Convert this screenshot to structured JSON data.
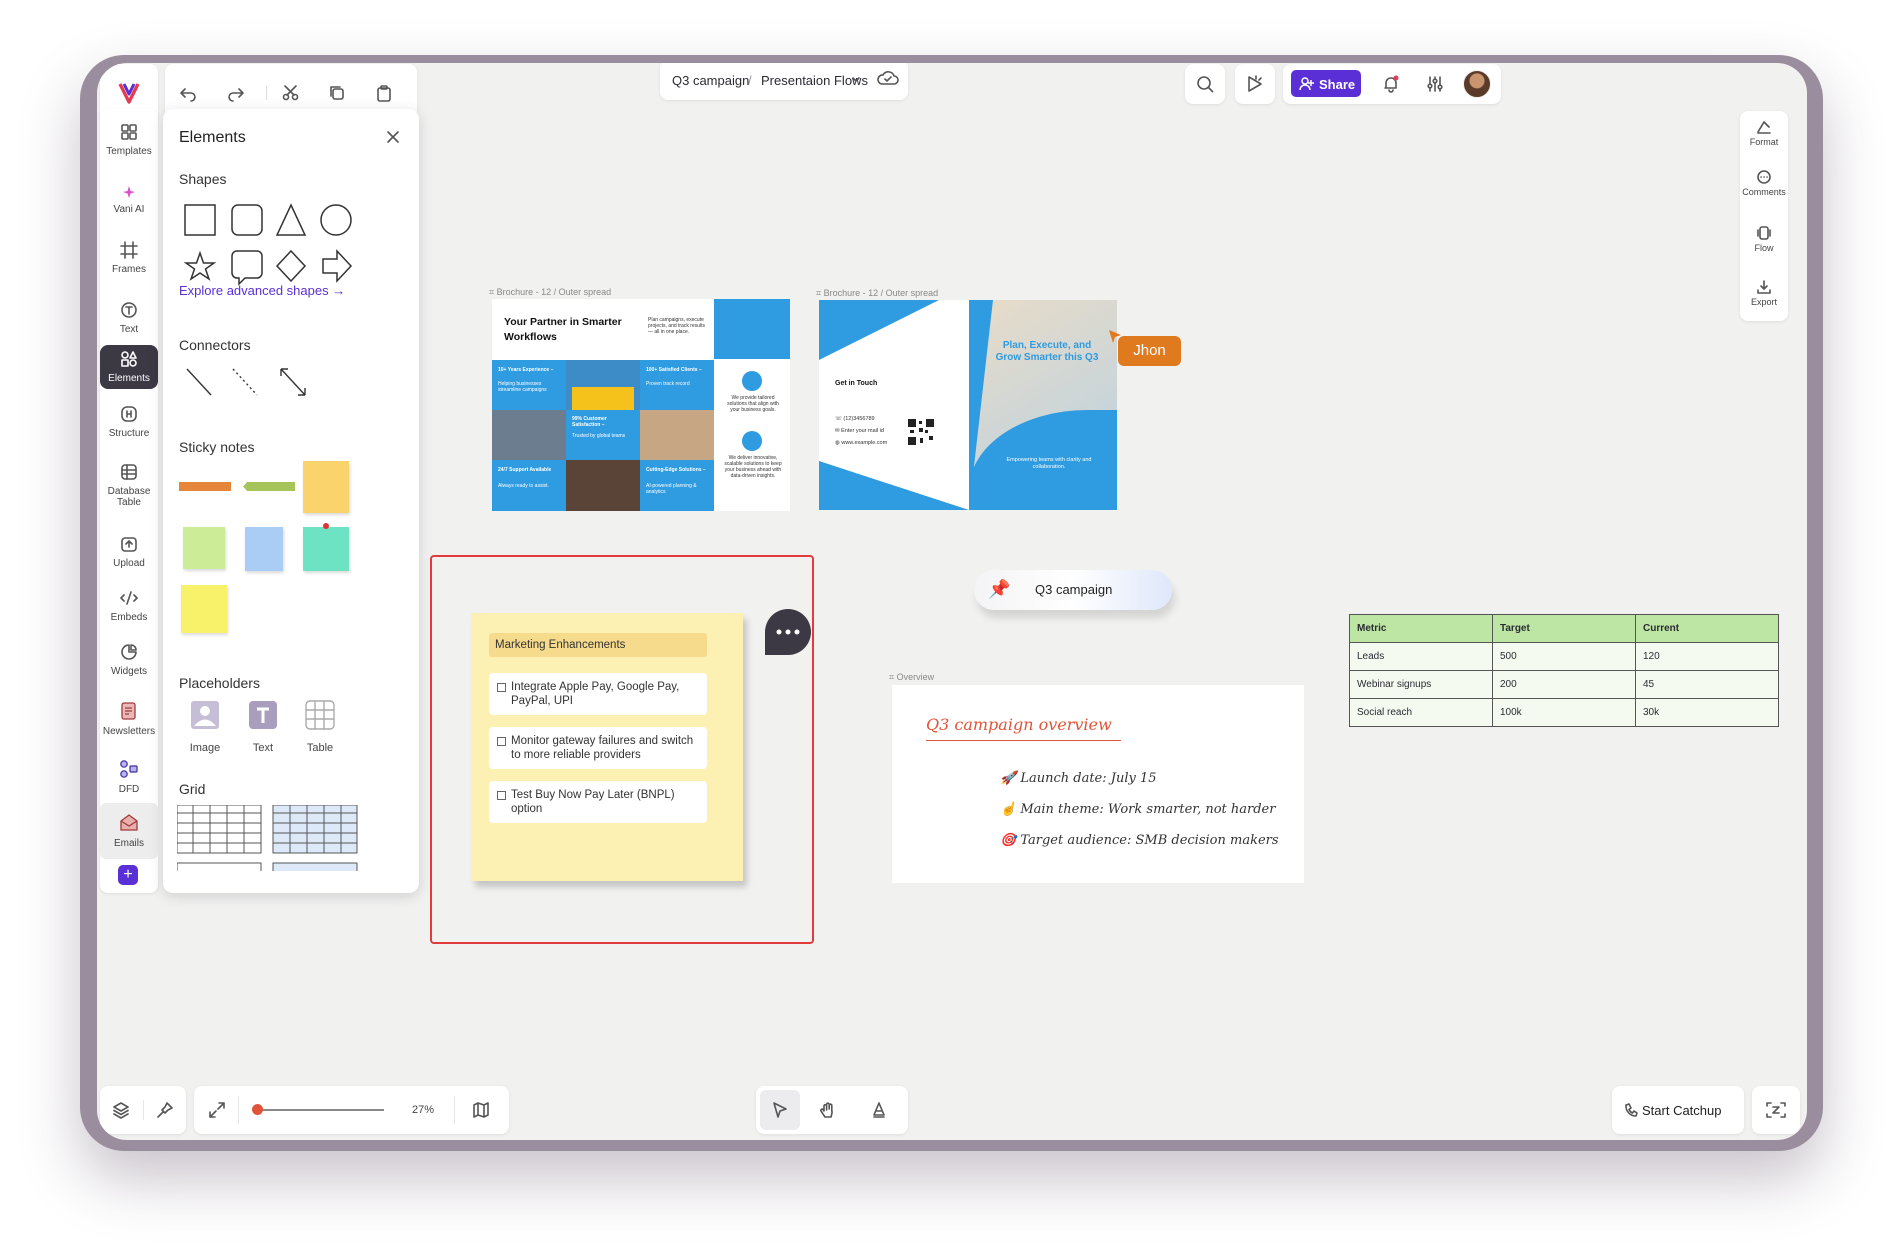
{
  "breadcrumb": {
    "project": "Q3 campaign",
    "separator": "/",
    "page": "Presentaion Flows"
  },
  "share_label": "Share",
  "rail": [
    {
      "label": "Templates",
      "icon": "templates-icon"
    },
    {
      "label": "Vani AI",
      "icon": "sparkle-icon"
    },
    {
      "label": "Frames",
      "icon": "frame-icon"
    },
    {
      "label": "Text",
      "icon": "text-icon"
    },
    {
      "label": "Elements",
      "icon": "elements-icon"
    },
    {
      "label": "Structure",
      "icon": "structure-icon"
    },
    {
      "label": "Database Table",
      "icon": "database-table-icon"
    },
    {
      "label": "Upload",
      "icon": "upload-icon"
    },
    {
      "label": "Embeds",
      "icon": "embeds-icon"
    },
    {
      "label": "Widgets",
      "icon": "widgets-icon"
    },
    {
      "label": "Newsletters",
      "icon": "newsletters-icon"
    },
    {
      "label": "DFD",
      "icon": "dfd-icon"
    },
    {
      "label": "Emails",
      "icon": "emails-icon"
    }
  ],
  "panel": {
    "title": "Elements",
    "shapes_title": "Shapes",
    "explore_link": "Explore advanced shapes",
    "connectors_title": "Connectors",
    "sticky_title": "Sticky notes",
    "placeholders_title": "Placeholders",
    "placeholders": [
      "Image",
      "Text",
      "Table"
    ],
    "grid_title": "Grid"
  },
  "right_rail": [
    "Format",
    "Comments",
    "Flow",
    "Export"
  ],
  "brochure_left": {
    "caption": "Brochure - 12 / Outer spread",
    "headline": "Your Partner in Smarter Workflows",
    "side_text": "Plan campaigns, execute projects, and track results — all in one place.",
    "tiles": [
      "10+ Years Experience –",
      "Helping businesses streamline campaigns",
      "100+ Satisfied Clients –",
      "Proven track record",
      "99% Customer Satisfaction –",
      "Trusted by global teams",
      "24/7 Support Available",
      "Always ready to assist.",
      "Cutting-Edge Solutions –",
      "AI-powered planning & analytics"
    ],
    "right_text_1": "We provide tailored solutions that align with your business goals.",
    "right_text_2": "We deliver innovative, scalable solutions to keep your business ahead with data-driven insights."
  },
  "brochure_right": {
    "caption": "Brochure - 12 / Outer spread",
    "contact_title": "Get in Touch",
    "contacts": [
      "(12)3456789",
      "Enter your mail id",
      "www.example.com"
    ],
    "headline": "Plan, Execute, and Grow Smarter this Q3",
    "subline": "Empowering teams with clarity and collaboration."
  },
  "cursor_label": "Jhon",
  "sticky": {
    "title": "Marketing Enhancements",
    "items": [
      "Integrate Apple Pay, Google Pay, PayPal, UPI",
      "Monitor gateway failures and switch to more reliable providers",
      "Test Buy Now Pay Later (BNPL) option"
    ]
  },
  "pin_label": "Q3 campaign",
  "overview": {
    "caption": "Overview",
    "title": "Q3 campaign overview",
    "lines": [
      "Launch date: July 15",
      "Main theme: Work smarter, not harder",
      "Target audience: SMB decision makers"
    ]
  },
  "table": {
    "headers": [
      "Metric",
      "Target",
      "Current"
    ],
    "rows": [
      [
        "Leads",
        "500",
        "120"
      ],
      [
        "Webinar signups",
        "200",
        "45"
      ],
      [
        "Social reach",
        "100k",
        "30k"
      ]
    ]
  },
  "zoom_label": "27%",
  "catchup_label": "Start Catchup",
  "colors": {
    "accent": "#5b2fd6",
    "cursor": "#e07a1f",
    "note_bg": "#fdf0b3",
    "selection": "#e23b3b",
    "brochure_blue": "#2f9be0"
  }
}
